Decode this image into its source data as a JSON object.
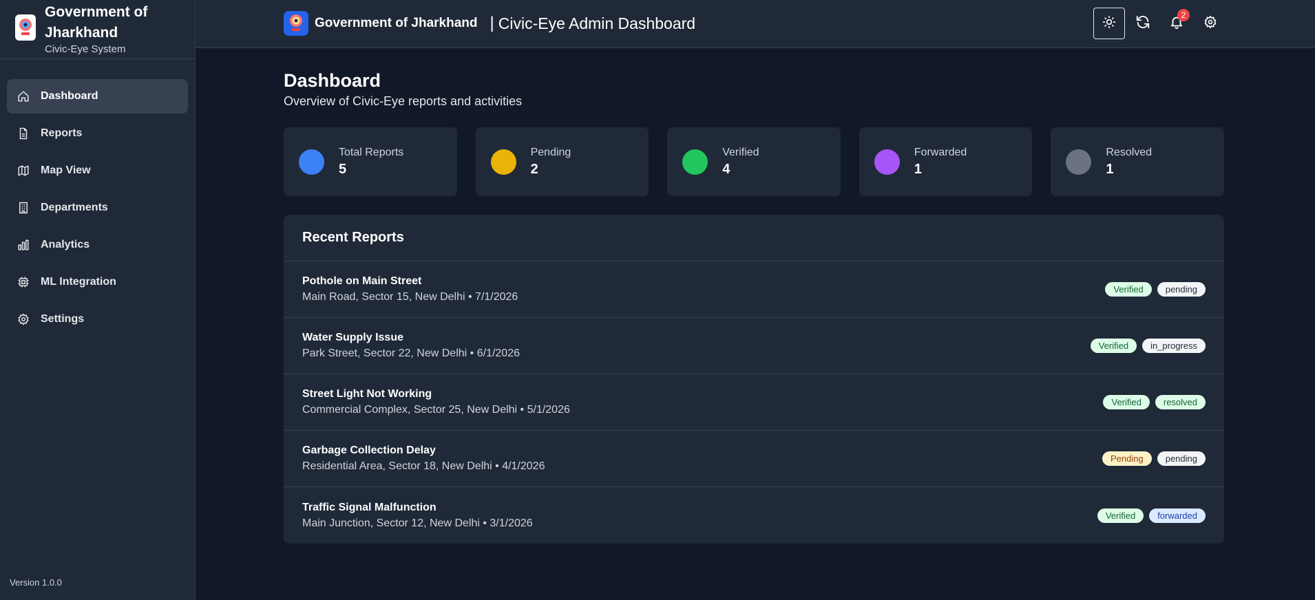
{
  "sidebar": {
    "brand_title": "Government of Jharkhand",
    "brand_sub": "Civic-Eye System",
    "items": [
      {
        "label": "Dashboard",
        "icon": "home-icon"
      },
      {
        "label": "Reports",
        "icon": "file-icon"
      },
      {
        "label": "Map View",
        "icon": "map-icon"
      },
      {
        "label": "Departments",
        "icon": "building-icon"
      },
      {
        "label": "Analytics",
        "icon": "bar-chart-icon"
      },
      {
        "label": "ML Integration",
        "icon": "cpu-icon"
      },
      {
        "label": "Settings",
        "icon": "gear-icon"
      }
    ],
    "active": "Dashboard",
    "version": "Version 1.0.0"
  },
  "topbar": {
    "gov": "Government of Jharkhand",
    "separator": "|",
    "title": "Civic-Eye Admin Dashboard",
    "notifications": "2"
  },
  "page": {
    "title": "Dashboard",
    "subtitle": "Overview of Civic-Eye reports and activities"
  },
  "stats": [
    {
      "label": "Total Reports",
      "value": "5",
      "color": "#3b82f6"
    },
    {
      "label": "Pending",
      "value": "2",
      "color": "#eab308"
    },
    {
      "label": "Verified",
      "value": "4",
      "color": "#22c55e"
    },
    {
      "label": "Forwarded",
      "value": "1",
      "color": "#a855f7"
    },
    {
      "label": "Resolved",
      "value": "1",
      "color": "#6b7280"
    }
  ],
  "recent": {
    "heading": "Recent Reports",
    "rows": [
      {
        "title": "Pothole on Main Street",
        "sub": "Main Road, Sector 15, New Delhi • 7/1/2026",
        "verification": "Verified",
        "status": "pending"
      },
      {
        "title": "Water Supply Issue",
        "sub": "Park Street, Sector 22, New Delhi • 6/1/2026",
        "verification": "Verified",
        "status": "in_progress"
      },
      {
        "title": "Street Light Not Working",
        "sub": "Commercial Complex, Sector 25, New Delhi • 5/1/2026",
        "verification": "Verified",
        "status": "resolved"
      },
      {
        "title": "Garbage Collection Delay",
        "sub": "Residential Area, Sector 18, New Delhi • 4/1/2026",
        "verification": "Pending",
        "status": "pending"
      },
      {
        "title": "Traffic Signal Malfunction",
        "sub": "Main Junction, Sector 12, New Delhi • 3/1/2026",
        "verification": "Verified",
        "status": "forwarded"
      }
    ]
  }
}
